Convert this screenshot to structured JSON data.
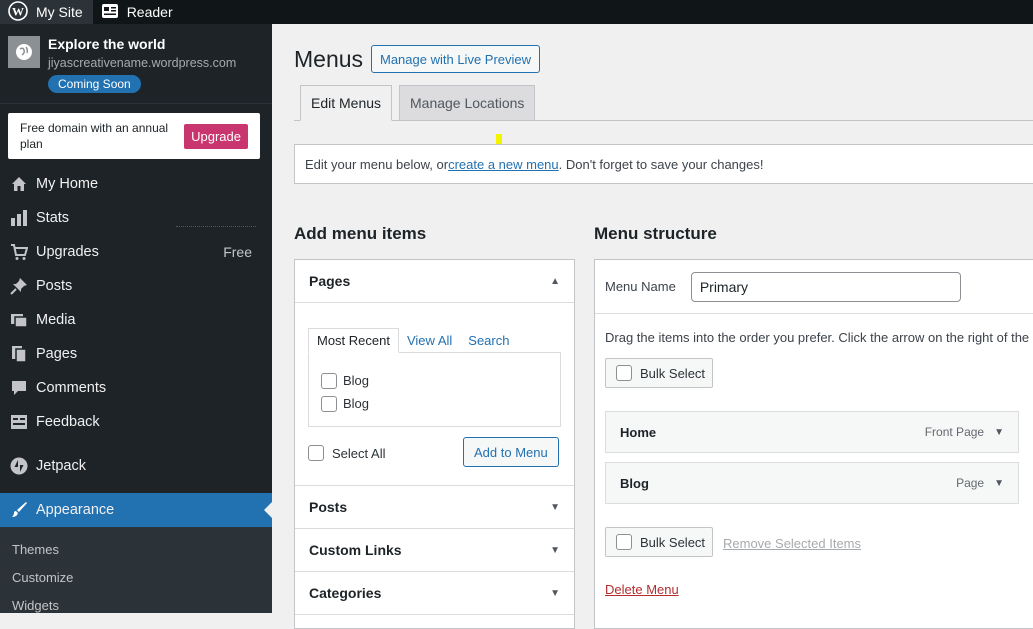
{
  "topbar": {
    "my_site": "My Site",
    "reader": "Reader"
  },
  "site": {
    "title": "Explore the world",
    "url": "jiyascreativename.wordpress.com",
    "badge": "Coming Soon"
  },
  "promo": {
    "text": "Free domain with an annual plan",
    "button": "Upgrade"
  },
  "nav": {
    "items": [
      {
        "label": "My Home",
        "icon": "home-icon"
      },
      {
        "label": "Stats",
        "icon": "stats-icon"
      },
      {
        "label": "Upgrades",
        "icon": "cart-icon",
        "badge": "Free"
      },
      {
        "label": "Posts",
        "icon": "pin-icon"
      },
      {
        "label": "Media",
        "icon": "media-icon"
      },
      {
        "label": "Pages",
        "icon": "pages-icon"
      },
      {
        "label": "Comments",
        "icon": "comment-icon"
      },
      {
        "label": "Feedback",
        "icon": "feedback-icon"
      },
      {
        "label": "Jetpack",
        "icon": "jetpack-icon"
      },
      {
        "label": "Appearance",
        "icon": "brush-icon"
      }
    ],
    "sub_items": [
      "Themes",
      "Customize",
      "Widgets"
    ]
  },
  "main": {
    "title": "Menus",
    "live_preview": "Manage with Live Preview",
    "tabs": [
      "Edit Menus",
      "Manage Locations"
    ],
    "notice": {
      "before": "Edit your menu below, or ",
      "link": "create a new menu",
      "after": ". Don't forget to save your changes!"
    }
  },
  "add_items": {
    "heading": "Add menu items",
    "pages": {
      "title": "Pages",
      "tabs": [
        "Most Recent",
        "View All",
        "Search"
      ],
      "items": [
        "Blog",
        "Blog"
      ],
      "select_all": "Select All",
      "add_button": "Add to Menu"
    },
    "sections": [
      "Posts",
      "Custom Links",
      "Categories"
    ]
  },
  "structure": {
    "heading": "Menu structure",
    "menu_name_label": "Menu Name",
    "menu_name_value": "Primary",
    "drag_hint": "Drag the items into the order you prefer. Click the arrow on the right of the",
    "bulk_select": "Bulk Select",
    "items": [
      {
        "title": "Home",
        "type": "Front Page"
      },
      {
        "title": "Blog",
        "type": "Page"
      }
    ],
    "remove_selected": "Remove Selected Items",
    "delete_menu": "Delete Menu"
  },
  "colors": {
    "accent": "#2271b1",
    "sidebar_bg": "#1d2327",
    "upgrade": "#c9356e",
    "delete": "#b32d2e"
  }
}
